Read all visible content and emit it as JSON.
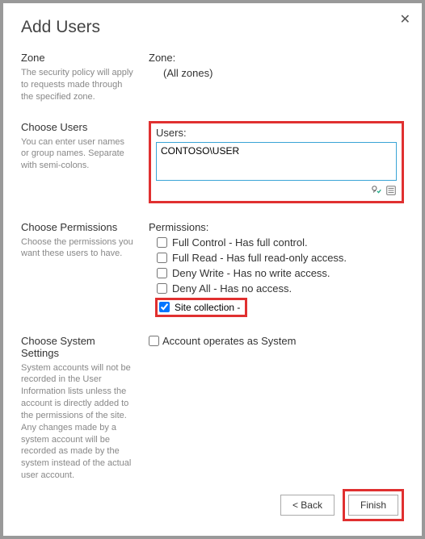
{
  "dialog": {
    "title": "Add Users"
  },
  "sections": {
    "zone": {
      "title": "Zone",
      "desc": "The security policy will apply to requests made through the specified zone.",
      "label": "Zone:",
      "value": "(All zones)"
    },
    "users": {
      "title": "Choose Users",
      "desc": "You can enter user names or group names. Separate with semi-colons.",
      "label": "Users:",
      "input_value": "CONTOSO\\USER"
    },
    "permissions": {
      "title": "Choose Permissions",
      "desc": "Choose the permissions you want these users to have.",
      "label": "Permissions:",
      "items": [
        {
          "label": "Full Control - Has full control.",
          "checked": false
        },
        {
          "label": "Full Read - Has full read-only access.",
          "checked": false
        },
        {
          "label": "Deny Write - Has no write access.",
          "checked": false
        },
        {
          "label": "Deny All - Has no access.",
          "checked": false
        },
        {
          "label": "Site collection -",
          "checked": true,
          "highlight": true
        }
      ]
    },
    "system": {
      "title": "Choose System Settings",
      "desc": "System accounts will not be recorded in the User Information lists unless the account is directly added to the permissions of the site. Any changes made by a system account will be recorded as made by the system instead of the actual user account.",
      "checkbox_label": "Account operates as System",
      "checked": false
    }
  },
  "footer": {
    "back": "< Back",
    "finish": "Finish"
  },
  "highlight_color": "#e03030"
}
